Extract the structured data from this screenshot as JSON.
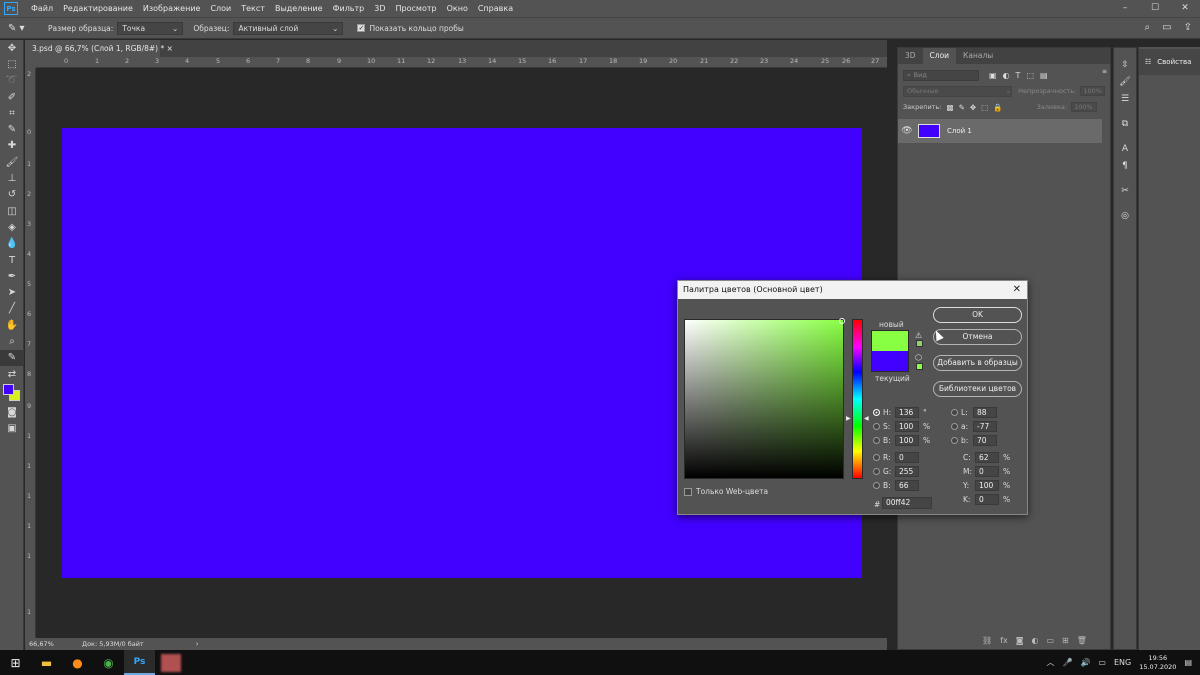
{
  "app": {
    "logo": "Ps",
    "menu": [
      "Файл",
      "Редактирование",
      "Изображение",
      "Слои",
      "Текст",
      "Выделение",
      "Фильтр",
      "3D",
      "Просмотр",
      "Окно",
      "Справка"
    ],
    "window_controls": [
      "–",
      "☐",
      "✕"
    ]
  },
  "options": {
    "sample_size_label": "Размер образца:",
    "sample_size_value": "Точка",
    "sample_label": "Образец:",
    "sample_value": "Активный слой",
    "show_ring_label": "Показать кольцо пробы"
  },
  "document": {
    "tab_title": "3.psd @ 66,7% (Слой 1, RGB/8#) *",
    "tab_close": "×",
    "canvas_color": "#4200ff",
    "ruler_h": [
      "0",
      "1",
      "2",
      "3",
      "4",
      "5",
      "6",
      "7",
      "8",
      "9",
      "10",
      "11",
      "12",
      "13",
      "14",
      "15",
      "16",
      "17",
      "18",
      "19",
      "20",
      "21",
      "22",
      "23",
      "24",
      "25",
      "26",
      "27"
    ],
    "ruler_v": [
      "2",
      "0",
      "1",
      "2",
      "3",
      "4",
      "5",
      "6",
      "7",
      "8",
      "9",
      "1",
      "1",
      "1",
      "1",
      "1",
      "1"
    ]
  },
  "status": {
    "zoom": "66,67%",
    "doc_info": "Док: 5,93M/0 байт",
    "arrow": "›"
  },
  "layers_panel": {
    "tabs": [
      "3D",
      "Слои",
      "Каналы"
    ],
    "active_tab": "Слои",
    "search_placeholder": "Вид",
    "blend_mode": "Обычные",
    "opacity_label": "Непрозрачность:",
    "opacity_value": "100%",
    "lock_label": "Закрепить:",
    "fill_label": "Заливка:",
    "fill_value": "100%",
    "layer_name": "Слой 1"
  },
  "properties": {
    "label": "Свойства"
  },
  "dialog": {
    "title": "Палитра цветов (Основной цвет)",
    "close": "✕",
    "new_label": "новый",
    "current_label": "текущий",
    "new_color": "#88ff42",
    "current_color": "#4200ff",
    "buttons": {
      "ok": "OK",
      "cancel": "Отмена",
      "add_swatch": "Добавить в образцы",
      "libraries": "Библиотеки цветов"
    },
    "hsb": {
      "h": {
        "key": "H:",
        "value": "136",
        "unit": "°"
      },
      "s": {
        "key": "S:",
        "value": "100",
        "unit": "%"
      },
      "b": {
        "key": "B:",
        "value": "100",
        "unit": "%"
      }
    },
    "rgb": {
      "r": {
        "key": "R:",
        "value": "0"
      },
      "g": {
        "key": "G:",
        "value": "255"
      },
      "b": {
        "key": "B:",
        "value": "66"
      }
    },
    "lab": {
      "l": {
        "key": "L:",
        "value": "88"
      },
      "a": {
        "key": "a:",
        "value": "-77"
      },
      "b": {
        "key": "b:",
        "value": "70"
      }
    },
    "cmyk": {
      "c": {
        "key": "C:",
        "value": "62",
        "unit": "%"
      },
      "m": {
        "key": "M:",
        "value": "0",
        "unit": "%"
      },
      "y": {
        "key": "Y:",
        "value": "100",
        "unit": "%"
      },
      "k": {
        "key": "K:",
        "value": "0",
        "unit": "%"
      }
    },
    "hex_label": "#",
    "hex_value": "00ff42",
    "web_only_label": "Только Web-цвета"
  },
  "taskbar": {
    "lang": "ENG",
    "time": "19:56",
    "date": "15.07.2020"
  }
}
